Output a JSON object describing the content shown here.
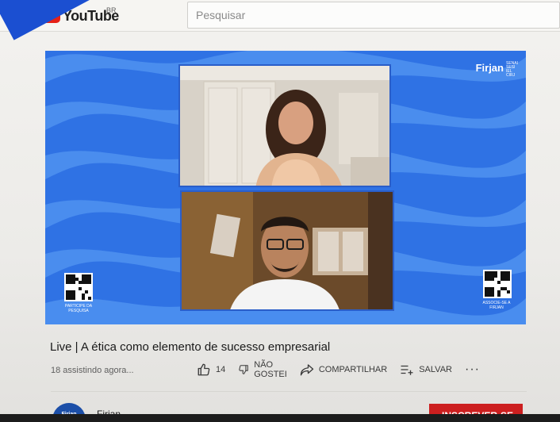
{
  "masthead": {
    "logo_text": "YouTube",
    "country_code": "BR",
    "search_placeholder": "Pesquisar"
  },
  "player": {
    "brand_name": "Firjan",
    "brand_subtitle": [
      "SENAI",
      "SESI",
      "IEL",
      "CIRJ"
    ],
    "qr_left_label": "PARTICIPE DA PESQUISA",
    "qr_right_label": "ASSOCIE-SE A FIRJAN"
  },
  "video": {
    "title": "Live | A ética como elemento de sucesso empresarial",
    "viewers": "18 assistindo agora...",
    "likes_count": "14",
    "dislike_label_line1": "NÃO",
    "dislike_label_line2": "GOSTEI",
    "share_label": "COMPARTILHAR",
    "save_label": "SALVAR",
    "more_label": "···"
  },
  "channel": {
    "avatar_text": "Firjan",
    "name": "Firjan",
    "subscribe_label": "INSCREVER-SE"
  },
  "colors": {
    "brand_blue": "#2f72e4",
    "youtube_red": "#e62117",
    "subscribe_red": "#cc1f1f"
  }
}
